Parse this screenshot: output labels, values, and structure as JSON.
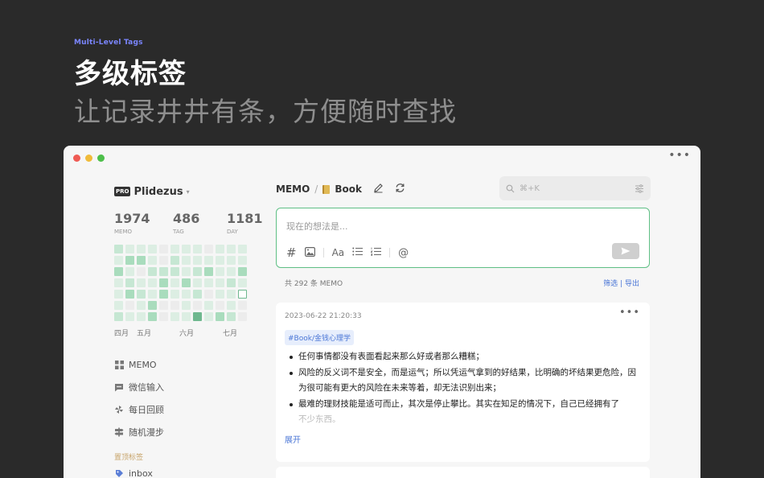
{
  "hero": {
    "eyebrow": "Multi-Level Tags",
    "title": "多级标签",
    "subtitle": "让记录井井有条，方便随时查找"
  },
  "window": {
    "more_icon": "ellipsis-icon"
  },
  "sidebar": {
    "pro_badge": "PRO",
    "workspace": "Plidezus",
    "stats": [
      {
        "value": "1974",
        "label": "MEMO"
      },
      {
        "value": "486",
        "label": "TAG"
      },
      {
        "value": "1181",
        "label": "DAY"
      }
    ],
    "heatmap_levels": [
      [
        2,
        1,
        1,
        1,
        0,
        1,
        1,
        1,
        0,
        1,
        1,
        1
      ],
      [
        1,
        3,
        3,
        1,
        0,
        2,
        1,
        1,
        1,
        1,
        1,
        1
      ],
      [
        3,
        1,
        0,
        2,
        2,
        2,
        1,
        2,
        3,
        1,
        1,
        3
      ],
      [
        1,
        2,
        1,
        1,
        3,
        1,
        3,
        1,
        1,
        1,
        2,
        1
      ],
      [
        1,
        3,
        2,
        1,
        3,
        1,
        1,
        2,
        0,
        1,
        1,
        5
      ],
      [
        1,
        0,
        1,
        3,
        0,
        0,
        1,
        0,
        1,
        0,
        1,
        0
      ],
      [
        2,
        1,
        1,
        3,
        0,
        1,
        1,
        4,
        1,
        3,
        2,
        0
      ]
    ],
    "months": [
      "四月",
      "五月",
      "六月",
      "七月"
    ],
    "nav": [
      {
        "label": "MEMO",
        "icon": "grid-icon"
      },
      {
        "label": "微信输入",
        "icon": "chat-icon"
      },
      {
        "label": "每日回顾",
        "icon": "pinwheel-icon"
      },
      {
        "label": "随机漫步",
        "icon": "signpost-icon"
      }
    ],
    "pinned_label": "置顶标签",
    "pinned": [
      {
        "label": "inbox",
        "icon": "tag-icon"
      }
    ]
  },
  "main": {
    "breadcrumb_root": "MEMO",
    "breadcrumb_sep": "/",
    "breadcrumb_tag": "Book",
    "search_placeholder": "⌘+K",
    "editor_placeholder": "现在的想法是...",
    "editor_tools": {
      "hash": "#",
      "font": "Aa",
      "mention": "@"
    },
    "memo_count": "共 292 条 MEMO",
    "filter_label": "筛选",
    "actions_sep": "|",
    "export_label": "导出",
    "card": {
      "date": "2023-06-22 21:20:33",
      "tag": "#Book/金钱心理学",
      "lines": [
        "任何事情都没有表面看起来那么好或者那么糟糕；",
        "风险的反义词不是安全，而是运气；所以凭运气拿到的好结果，比明确的坏结果更危险，因为很可能有更大的风险在未来等着，却无法识别出来；",
        "最难的理财技能是适可而止，其次是停止攀比。其实在知足的情况下，自己已经拥有了",
        "不少东西。"
      ],
      "expand_label": "展开"
    }
  },
  "colors": {
    "accent_green": "#5fbf85",
    "link_blue": "#4a76d6",
    "pinned_gold": "#c8a56c"
  }
}
